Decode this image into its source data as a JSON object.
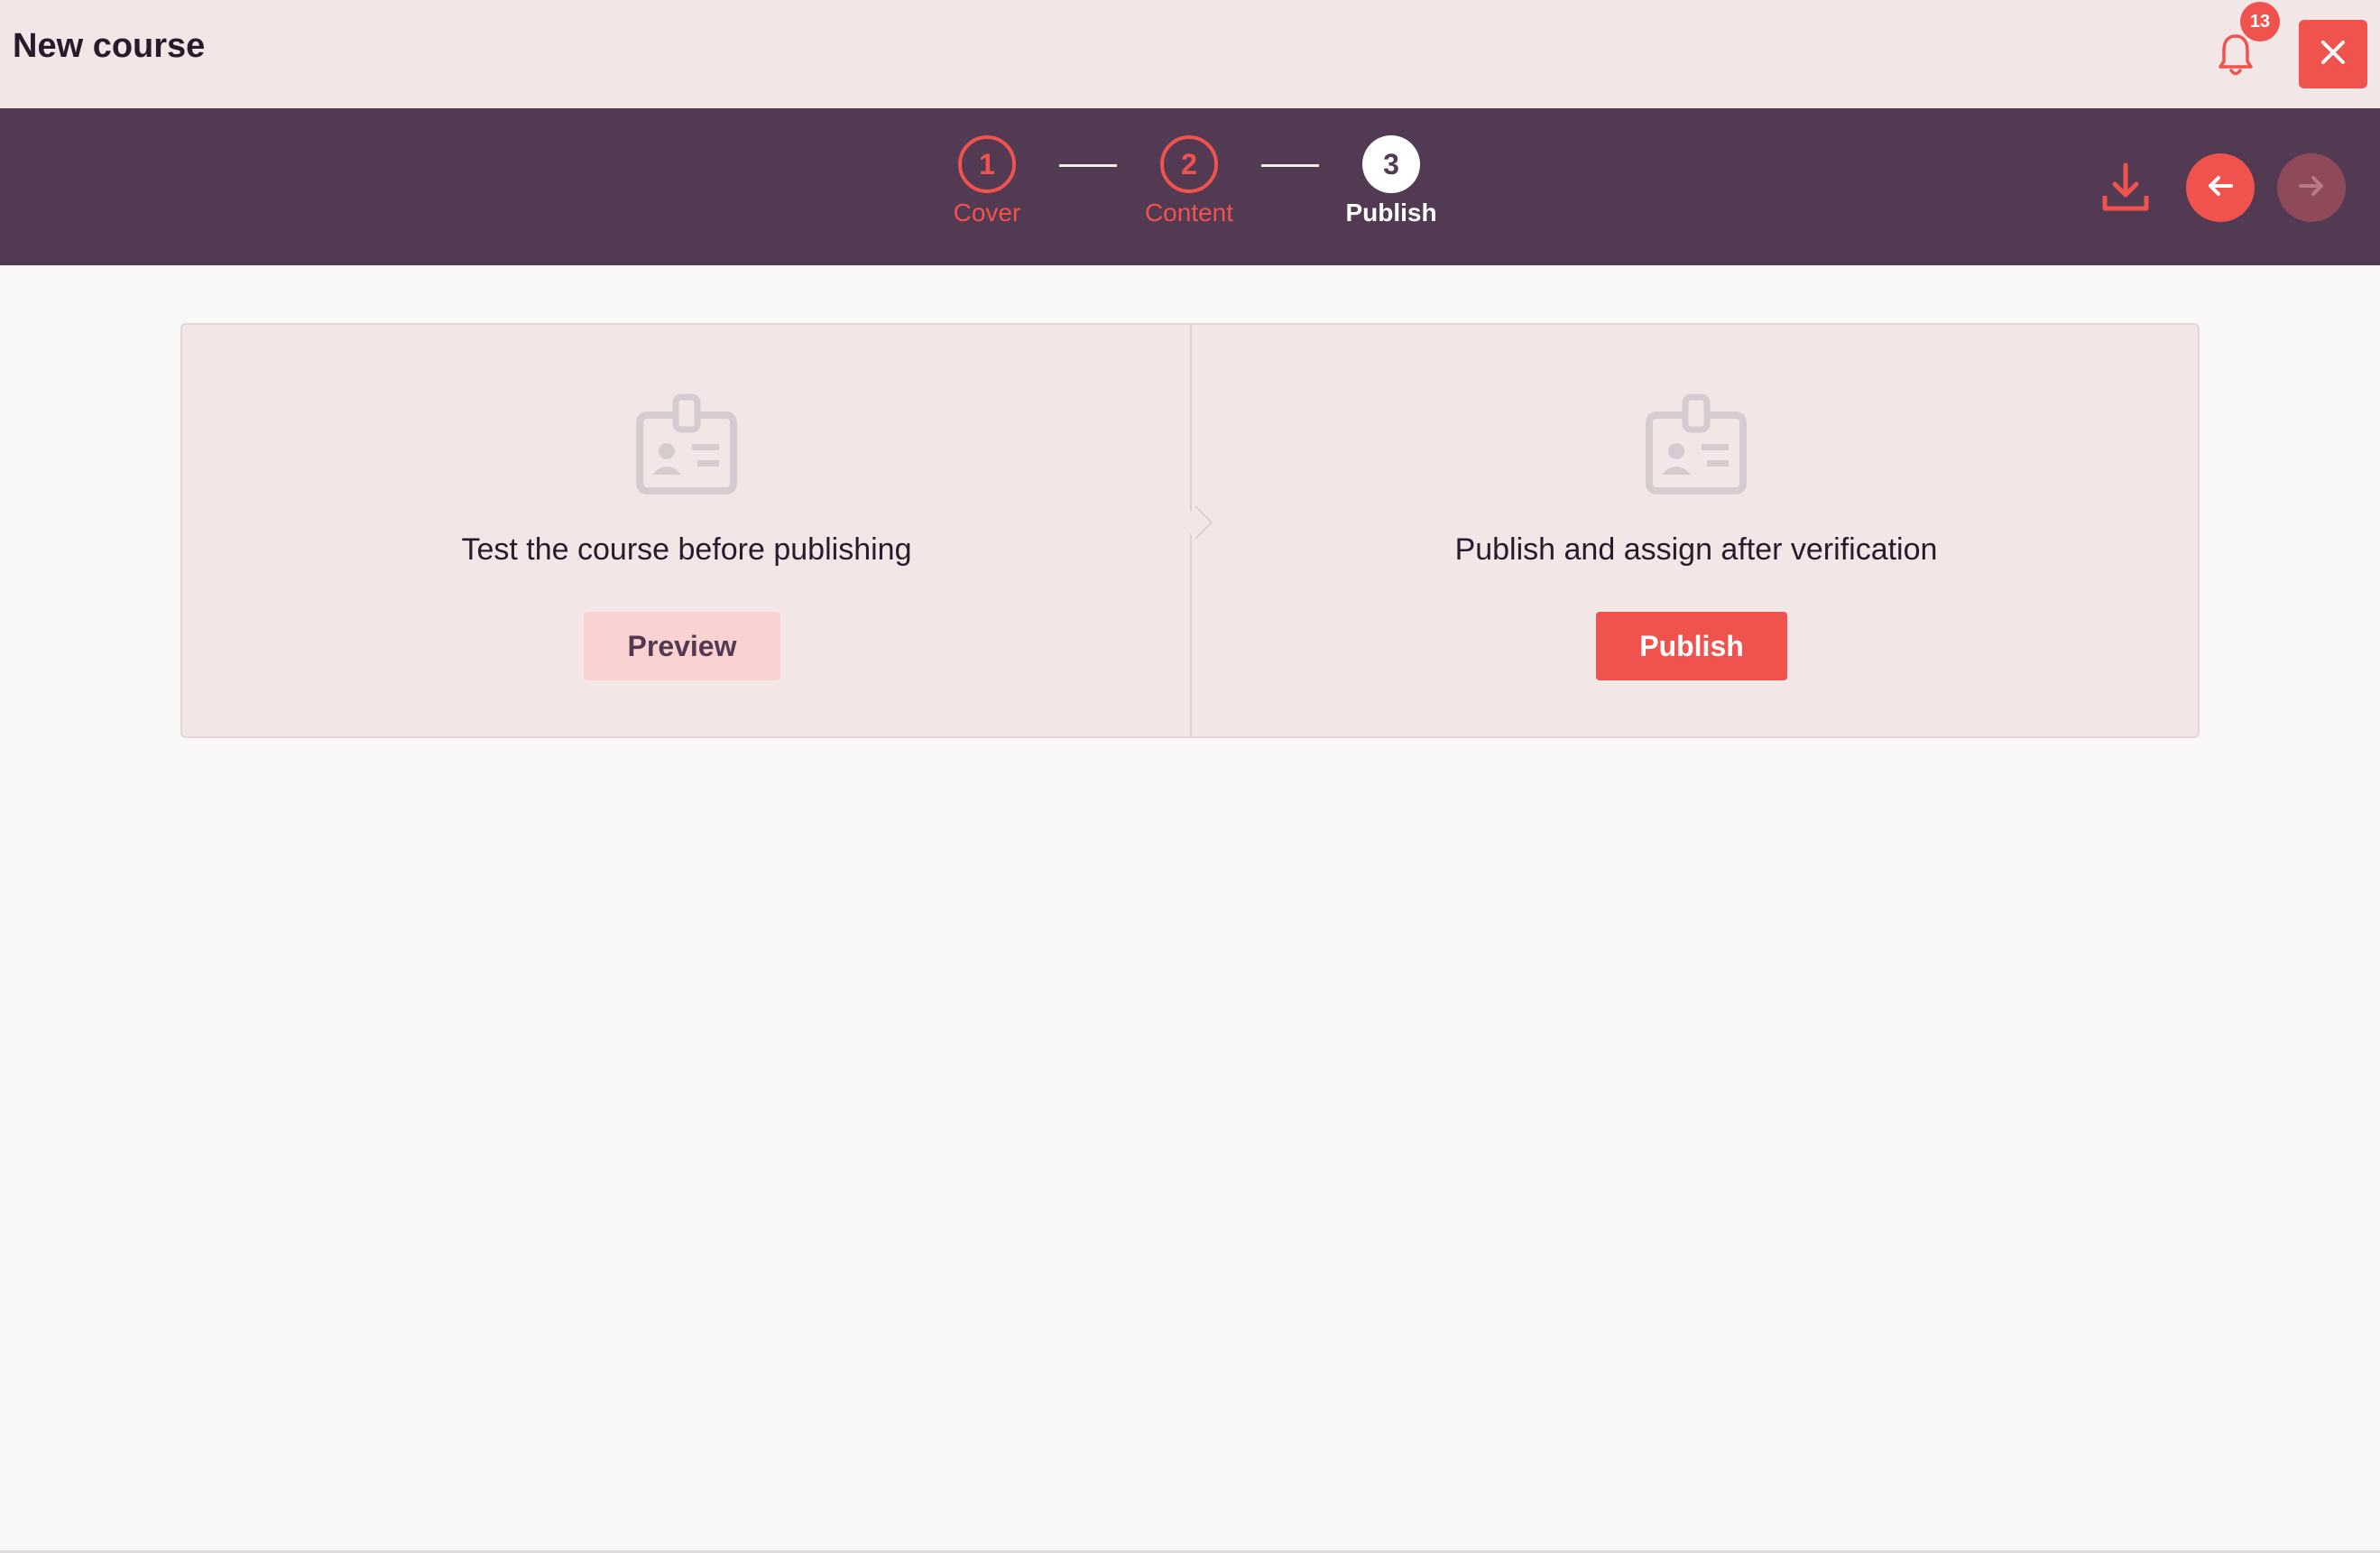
{
  "header": {
    "title": "New course",
    "notification_count": "13",
    "bell_icon": "bell-icon",
    "close_icon": "close-icon"
  },
  "steps": [
    {
      "number": "1",
      "label": "Cover",
      "state": "done"
    },
    {
      "number": "2",
      "label": "Content",
      "state": "done"
    },
    {
      "number": "3",
      "label": "Publish",
      "state": "active"
    }
  ],
  "toolbar": {
    "download_icon": "download-icon",
    "prev_icon": "arrow-left-icon",
    "next_icon": "arrow-right-icon",
    "next_enabled": false
  },
  "cards": {
    "test": {
      "icon": "id-badge-icon",
      "caption": "Test the course before publishing",
      "button_label": "Preview"
    },
    "publish": {
      "icon": "id-badge-icon",
      "caption": "Publish and assign after verification",
      "button_label": "Publish"
    }
  },
  "colors": {
    "accent": "#f0524e",
    "stepbar": "#533a53",
    "header_bg": "#f2e6e6"
  }
}
